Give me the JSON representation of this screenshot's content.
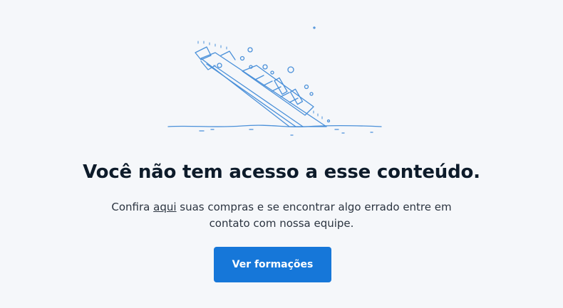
{
  "illustration": {
    "icon": "sinking-ship-icon",
    "stroke_color": "#4a90d9"
  },
  "heading": "Você não tem acesso a esse conteúdo.",
  "message": {
    "before_link": "Confira ",
    "link_text": "aqui",
    "after_link_line1": " suas compras e se encontrar algo errado entre em",
    "line2": "contato com nossa equipe."
  },
  "cta": {
    "label": "Ver formações",
    "color": "#1677d9"
  },
  "colors": {
    "background": "#f5f7fa",
    "heading": "#0d1b2a",
    "text": "#2b3440"
  }
}
